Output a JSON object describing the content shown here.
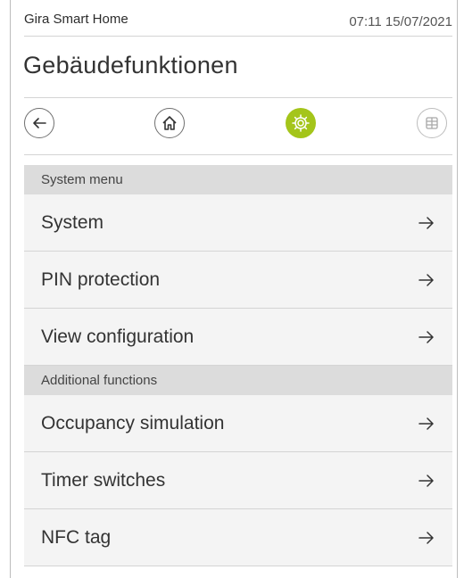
{
  "status_bar": {
    "app_name": "Gira Smart Home",
    "clock": "07:11 15/07/2021"
  },
  "page": {
    "title": "Gebäudefunktionen"
  },
  "nav": {
    "back_icon": "arrow-left-icon",
    "home_icon": "home-icon",
    "settings_icon": "gear-icon",
    "grid_icon": "grid-icon",
    "active": "settings",
    "accent_color": "#a4c51a"
  },
  "sections": [
    {
      "header": "System menu",
      "items": [
        "System",
        "PIN protection",
        "View configuration"
      ]
    },
    {
      "header": "Additional functions",
      "items": [
        "Occupancy simulation",
        "Timer switches",
        "NFC tag"
      ]
    }
  ]
}
